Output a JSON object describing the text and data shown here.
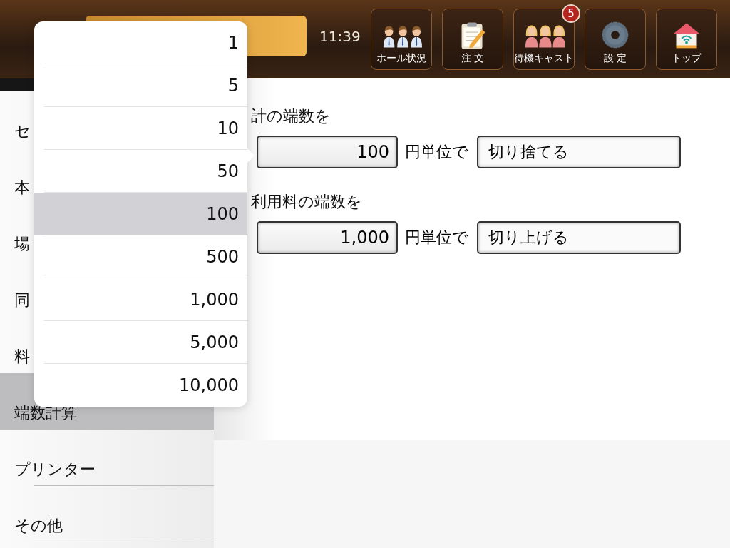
{
  "header": {
    "time": "11:39",
    "toolbar": [
      {
        "kind": "staff",
        "label": "ホール状況"
      },
      {
        "kind": "order",
        "label": "注 文"
      },
      {
        "kind": "cast",
        "label": "待機キャスト",
        "badge": "5"
      },
      {
        "kind": "settings",
        "label": "設 定"
      },
      {
        "kind": "home",
        "label": "トップ"
      }
    ]
  },
  "sidebar": {
    "items": [
      {
        "label": "セ",
        "selected": false
      },
      {
        "label": "本",
        "selected": false
      },
      {
        "label": "場",
        "selected": false
      },
      {
        "label": "同",
        "selected": false
      },
      {
        "label": "料",
        "selected": false
      },
      {
        "label": "端数計算",
        "selected": true
      },
      {
        "label": "プリンター",
        "selected": false
      },
      {
        "label": "その他",
        "selected": false
      }
    ]
  },
  "rounding": [
    {
      "label": "計の端数を",
      "amount": "100",
      "unit": "円単位で",
      "mode": "切り捨てる"
    },
    {
      "label": "利用料の端数を",
      "amount": "1,000",
      "unit": "円単位で",
      "mode": "切り上げる"
    }
  ],
  "picker": {
    "options": [
      {
        "label": "1",
        "selected": false
      },
      {
        "label": "5",
        "selected": false
      },
      {
        "label": "10",
        "selected": false
      },
      {
        "label": "50",
        "selected": false
      },
      {
        "label": "100",
        "selected": true
      },
      {
        "label": "500",
        "selected": false
      },
      {
        "label": "1,000",
        "selected": false
      },
      {
        "label": "5,000",
        "selected": false
      },
      {
        "label": "10,000",
        "selected": false
      }
    ]
  }
}
